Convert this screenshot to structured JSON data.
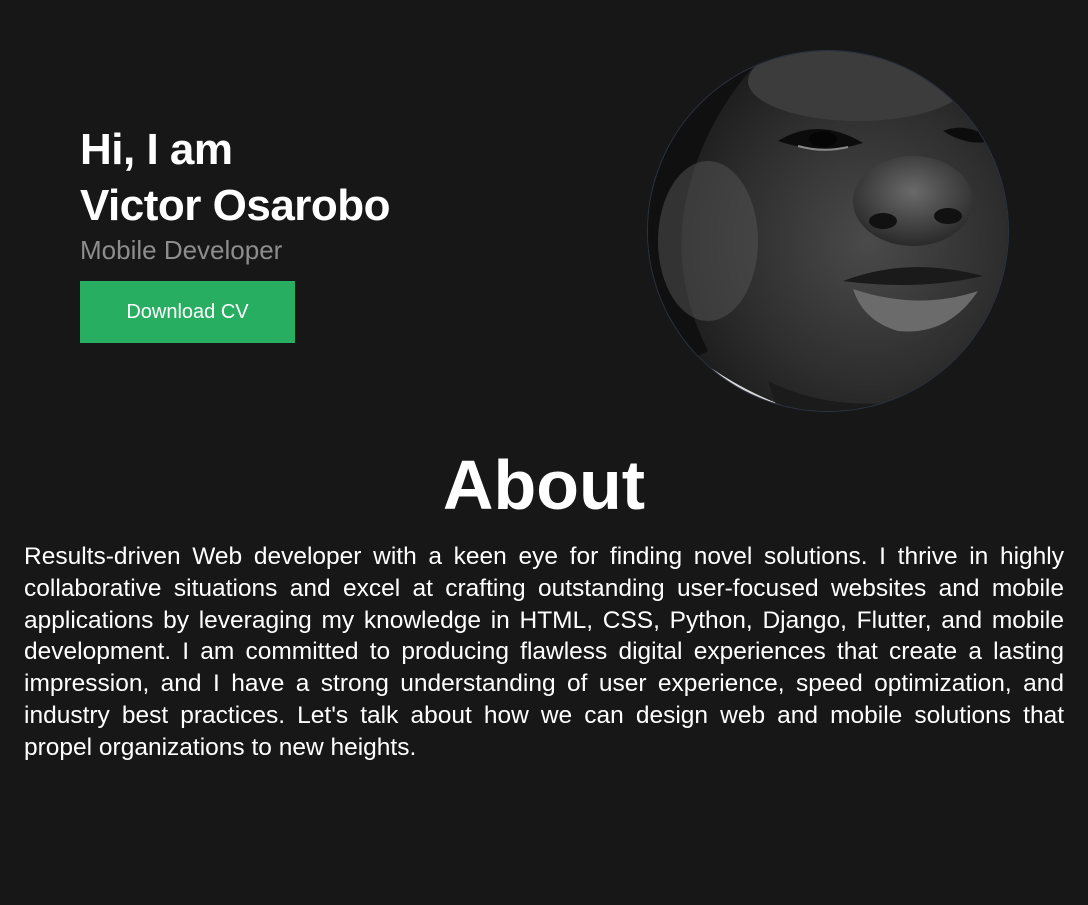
{
  "hero": {
    "greeting_line1": "Hi, I am",
    "name": "Victor Osarobo",
    "role": "Mobile Developer",
    "download_label": "Download CV",
    "button_color": "#27ae60",
    "avatar_icon": "profile-photo"
  },
  "about": {
    "title": "About",
    "text": "Results-driven Web developer with a keen eye for finding novel solutions. I thrive in highly collaborative situations and excel at crafting outstanding user-focused websites and mobile applications by leveraging my knowledge in HTML, CSS, Python, Django, Flutter, and mobile development. I am committed to producing flawless digital experiences that create a lasting impression, and I have a strong understanding of user experience, speed optimization, and industry best practices. Let's talk about how we can design web and mobile solutions that propel organizations to new heights."
  },
  "colors": {
    "background": "#171717",
    "text": "#ffffff",
    "muted": "#8d8d8d"
  }
}
